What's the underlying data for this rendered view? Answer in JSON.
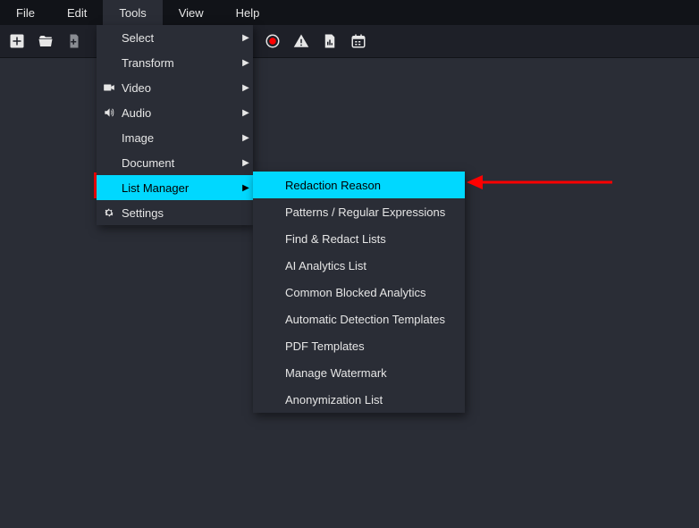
{
  "menubar": {
    "items": [
      "File",
      "Edit",
      "Tools",
      "View",
      "Help"
    ],
    "active_index": 2
  },
  "toolbar": {
    "icons": [
      "new-file-icon",
      "open-folder-icon",
      "add-page-icon",
      "record-icon",
      "warning-icon",
      "report-icon",
      "calendar-icon"
    ]
  },
  "tools_menu": {
    "items": [
      {
        "label": "Select",
        "icon": null,
        "submenu": true
      },
      {
        "label": "Transform",
        "icon": null,
        "submenu": true
      },
      {
        "label": "Video",
        "icon": "video",
        "submenu": true
      },
      {
        "label": "Audio",
        "icon": "audio",
        "submenu": true
      },
      {
        "label": "Image",
        "icon": null,
        "submenu": true
      },
      {
        "label": "Document",
        "icon": null,
        "submenu": true
      },
      {
        "label": "List Manager",
        "icon": null,
        "submenu": true,
        "highlight": true
      },
      {
        "label": "Settings",
        "icon": "gear",
        "submenu": false
      }
    ]
  },
  "list_manager_submenu": {
    "items": [
      {
        "label": "Redaction Reason",
        "highlight": true
      },
      {
        "label": "Patterns / Regular Expressions"
      },
      {
        "label": "Find & Redact Lists"
      },
      {
        "label": "AI Analytics List"
      },
      {
        "label": "Common Blocked Analytics"
      },
      {
        "label": "Automatic Detection Templates"
      },
      {
        "label": "PDF Templates"
      },
      {
        "label": "Manage Watermark"
      },
      {
        "label": "Anonymization List"
      }
    ]
  },
  "annotation": {
    "type": "arrow",
    "color": "#ff0000"
  }
}
